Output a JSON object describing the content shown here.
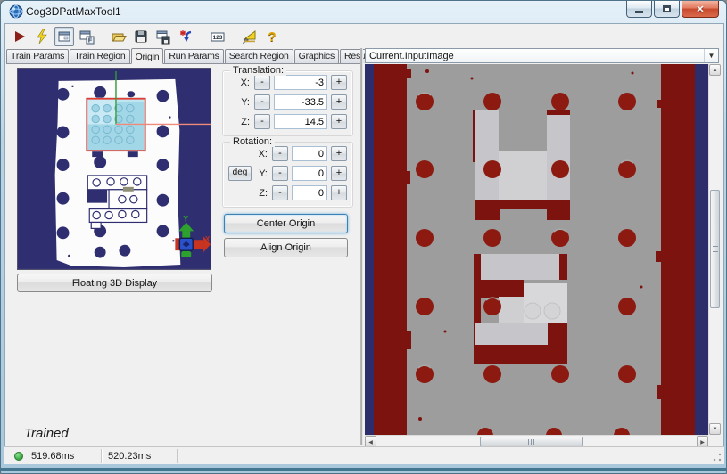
{
  "window": {
    "title": "Cog3DPatMaxTool1"
  },
  "toolbar": {
    "icons": [
      "run",
      "electrode",
      "show-image-display",
      "float-display",
      "open",
      "save",
      "save-image",
      "add-record",
      "pixel-values",
      "measure",
      "help"
    ],
    "pixel_grid_label": "123",
    "float_label": "F",
    "help_label": "?"
  },
  "tabs": {
    "items": [
      "Train Params",
      "Train Region",
      "Origin",
      "Run Params",
      "Search Region",
      "Graphics",
      "Results"
    ],
    "selected": "Origin"
  },
  "origin_page": {
    "translation": {
      "label": "Translation:",
      "rows": [
        {
          "axis": "X:",
          "value": "-3"
        },
        {
          "axis": "Y:",
          "value": "-33.5"
        },
        {
          "axis": "Z:",
          "value": "14.5"
        }
      ]
    },
    "rotation": {
      "label": "Rotation:",
      "deg_label": "deg",
      "rows": [
        {
          "axis": "X:",
          "value": "0"
        },
        {
          "axis": "Y:",
          "value": "0"
        },
        {
          "axis": "Z:",
          "value": "0"
        }
      ]
    },
    "minus_label": "-",
    "plus_label": "+",
    "center_button": "Center Origin",
    "align_button": "Align Origin",
    "floating_button": "Floating 3D Display",
    "train_status": "Trained"
  },
  "right_panel": {
    "combo_value": "Current.InputImage"
  },
  "status_bar": {
    "time1": "519.68ms",
    "time2": "520.23ms"
  }
}
